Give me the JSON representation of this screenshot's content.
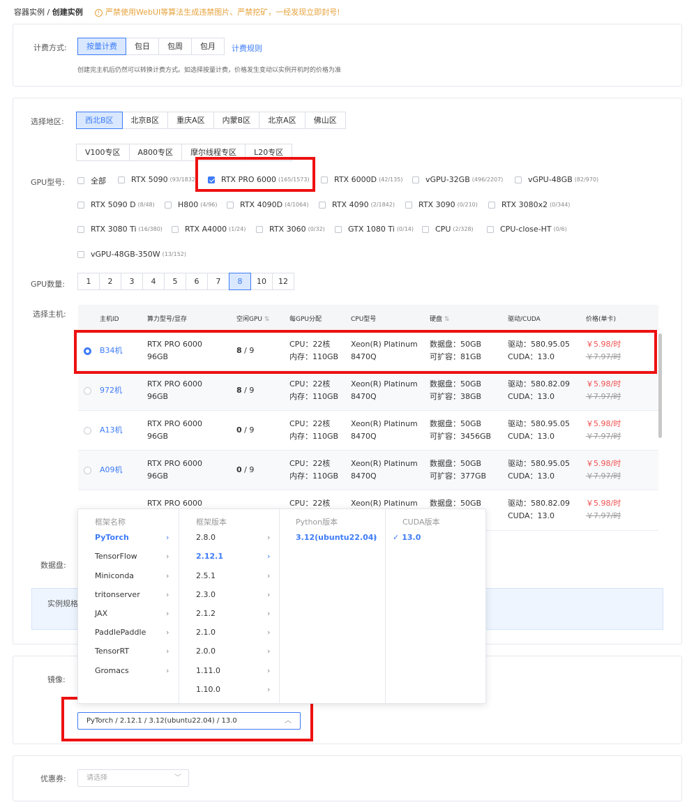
{
  "breadcrumb": {
    "parent": "容器实例",
    "sep": "/",
    "current": "创建实例"
  },
  "warning": {
    "icon": "warning-circle-icon",
    "text": "严禁使用WebUI等算法生成违禁图片、严禁挖矿，一经发现立即封号!"
  },
  "billing": {
    "label": "计费方式:",
    "options": [
      "按量计费",
      "包日",
      "包周",
      "包月"
    ],
    "selected": "按量计费",
    "rules_link": "计费规则",
    "note": "创建完主机后仍然可以转换计费方式。如选择按量计费，价格发生变动以实例开机时的价格为准"
  },
  "region": {
    "label": "选择地区:",
    "options": [
      "西北B区",
      "北京B区",
      "重庆A区",
      "内蒙B区",
      "北京A区",
      "佛山区"
    ],
    "selected": "西北B区",
    "zones": [
      "V100专区",
      "A800专区",
      "摩尔线程专区",
      "L20专区"
    ]
  },
  "gpu_model": {
    "label": "GPU型号:",
    "items": [
      {
        "name": "全部",
        "count": ""
      },
      {
        "name": "RTX 5090",
        "count": "(93/1832)"
      },
      {
        "name": "RTX PRO 6000",
        "count": "(165/1573)",
        "checked": true
      },
      {
        "name": "RTX 6000D",
        "count": "(42/135)"
      },
      {
        "name": "vGPU-32GB",
        "count": "(496/2207)"
      },
      {
        "name": "vGPU-48GB",
        "count": "(82/970)"
      },
      {
        "name": "RTX 5090 D",
        "count": "(8/48)"
      },
      {
        "name": "H800",
        "count": "(4/96)"
      },
      {
        "name": "RTX 4090D",
        "count": "(4/1064)"
      },
      {
        "name": "RTX 4090",
        "count": "(2/1842)"
      },
      {
        "name": "RTX 3090",
        "count": "(0/210)"
      },
      {
        "name": "RTX 3080x2",
        "count": "(0/344)"
      },
      {
        "name": "RTX 3080 Ti",
        "count": "(16/380)"
      },
      {
        "name": "RTX A4000",
        "count": "(1/24)"
      },
      {
        "name": "RTX 3060",
        "count": "(0/32)"
      },
      {
        "name": "GTX 1080 Ti",
        "count": "(0/14)"
      },
      {
        "name": "CPU",
        "count": "(2/328)"
      },
      {
        "name": "CPU-close-HT",
        "count": "(0/6)"
      },
      {
        "name": "vGPU-48GB-350W",
        "count": "(13/152)"
      }
    ]
  },
  "gpu_count": {
    "label": "GPU数量:",
    "options": [
      "1",
      "2",
      "3",
      "4",
      "5",
      "6",
      "7",
      "8",
      "10",
      "12"
    ],
    "selected": "8"
  },
  "host": {
    "label": "选择主机:",
    "columns": [
      "主机ID",
      "算力型号/显存",
      "空闲GPU",
      "每GPU分配",
      "CPU型号",
      "硬盘",
      "驱动/CUDA",
      "价格(单卡)"
    ],
    "rows": [
      {
        "id": "B34机",
        "model": "RTX PRO 6000",
        "vram": "96GB",
        "free": "8",
        "total": "/ 9",
        "cpu": "CPU：22核",
        "mem": "内存：110GB",
        "cpu_model": "Xeon(R) Platinum",
        "cpu_model2": "8470Q",
        "disk": "数据盘：50GB",
        "disk_ext": "可扩容：81GB",
        "driver": "驱动：580.95.05",
        "cuda": "CUDA：13.0",
        "price": "￥5.98/时",
        "orig": "￥7.97/时",
        "selected": true
      },
      {
        "id": "972机",
        "model": "RTX PRO 6000",
        "vram": "96GB",
        "free": "8",
        "total": "/ 9",
        "cpu": "CPU：22核",
        "mem": "内存：110GB",
        "cpu_model": "Xeon(R) Platinum",
        "cpu_model2": "8470Q",
        "disk": "数据盘：50GB",
        "disk_ext": "可扩容：38GB",
        "driver": "驱动：580.82.09",
        "cuda": "CUDA：13.0",
        "price": "￥5.98/时",
        "orig": "￥7.97/时"
      },
      {
        "id": "A13机",
        "model": "RTX PRO 6000",
        "vram": "96GB",
        "free": "0",
        "total": "/ 9",
        "cpu": "CPU：22核",
        "mem": "内存：110GB",
        "cpu_model": "Xeon(R) Platinum",
        "cpu_model2": "8470Q",
        "disk": "数据盘：50GB",
        "disk_ext": "可扩容：3456GB",
        "driver": "驱动：580.95.05",
        "cuda": "CUDA：13.0",
        "price": "￥5.98/时",
        "orig": "￥7.97/时"
      },
      {
        "id": "A09机",
        "model": "RTX PRO 6000",
        "vram": "96GB",
        "free": "0",
        "total": "/ 9",
        "cpu": "CPU：22核",
        "mem": "内存：110GB",
        "cpu_model": "Xeon(R) Platinum",
        "cpu_model2": "8470Q",
        "disk": "数据盘：50GB",
        "disk_ext": "可扩容：377GB",
        "driver": "驱动：580.95.05",
        "cuda": "CUDA：13.0",
        "price": "￥5.98/时",
        "orig": "￥7.97/时"
      },
      {
        "id": "",
        "model": "RTX PRO 6000",
        "vram": "",
        "free": "",
        "total": "",
        "cpu": "CPU：22核",
        "mem": "",
        "cpu_model": "Xeon(R) Platinum",
        "cpu_model2": "",
        "disk": "数据盘：50GB",
        "disk_ext": "",
        "driver": "驱动：580.82.09",
        "cuda": "CUDA：13.0",
        "price": "￥5.98/时",
        "orig": "￥7.97/时"
      }
    ]
  },
  "data_disk": {
    "label": "数据盘:"
  },
  "spec": {
    "label": "实例规格"
  },
  "image": {
    "label": "镜像:",
    "value": "PyTorch / 2.12.1 / 3.12(ubuntu22.04) / 13.0",
    "cascader": {
      "frameworks": {
        "header": "框架名称",
        "items": [
          "PyTorch",
          "TensorFlow",
          "Miniconda",
          "tritonserver",
          "JAX",
          "PaddlePaddle",
          "TensorRT",
          "Gromacs"
        ],
        "selected": "PyTorch"
      },
      "versions": {
        "header": "框架版本",
        "items": [
          "2.8.0",
          "2.12.1",
          "2.5.1",
          "2.3.0",
          "2.1.2",
          "2.1.0",
          "2.0.0",
          "1.11.0",
          "1.10.0"
        ],
        "selected": "2.12.1"
      },
      "python": {
        "header": "Python版本",
        "items": [
          "3.12(ubuntu22.04)"
        ],
        "selected": "3.12(ubuntu22.04)"
      },
      "cuda": {
        "header": "CUDA版本",
        "items": [
          "13.0"
        ],
        "selected": "13.0"
      }
    }
  },
  "coupon": {
    "label": "优惠券:",
    "placeholder": "请选择"
  },
  "colors": {
    "accent": "#3d7bf7",
    "warning": "#e6a23c",
    "price": "#f05050",
    "highlight": "#ee1111"
  }
}
